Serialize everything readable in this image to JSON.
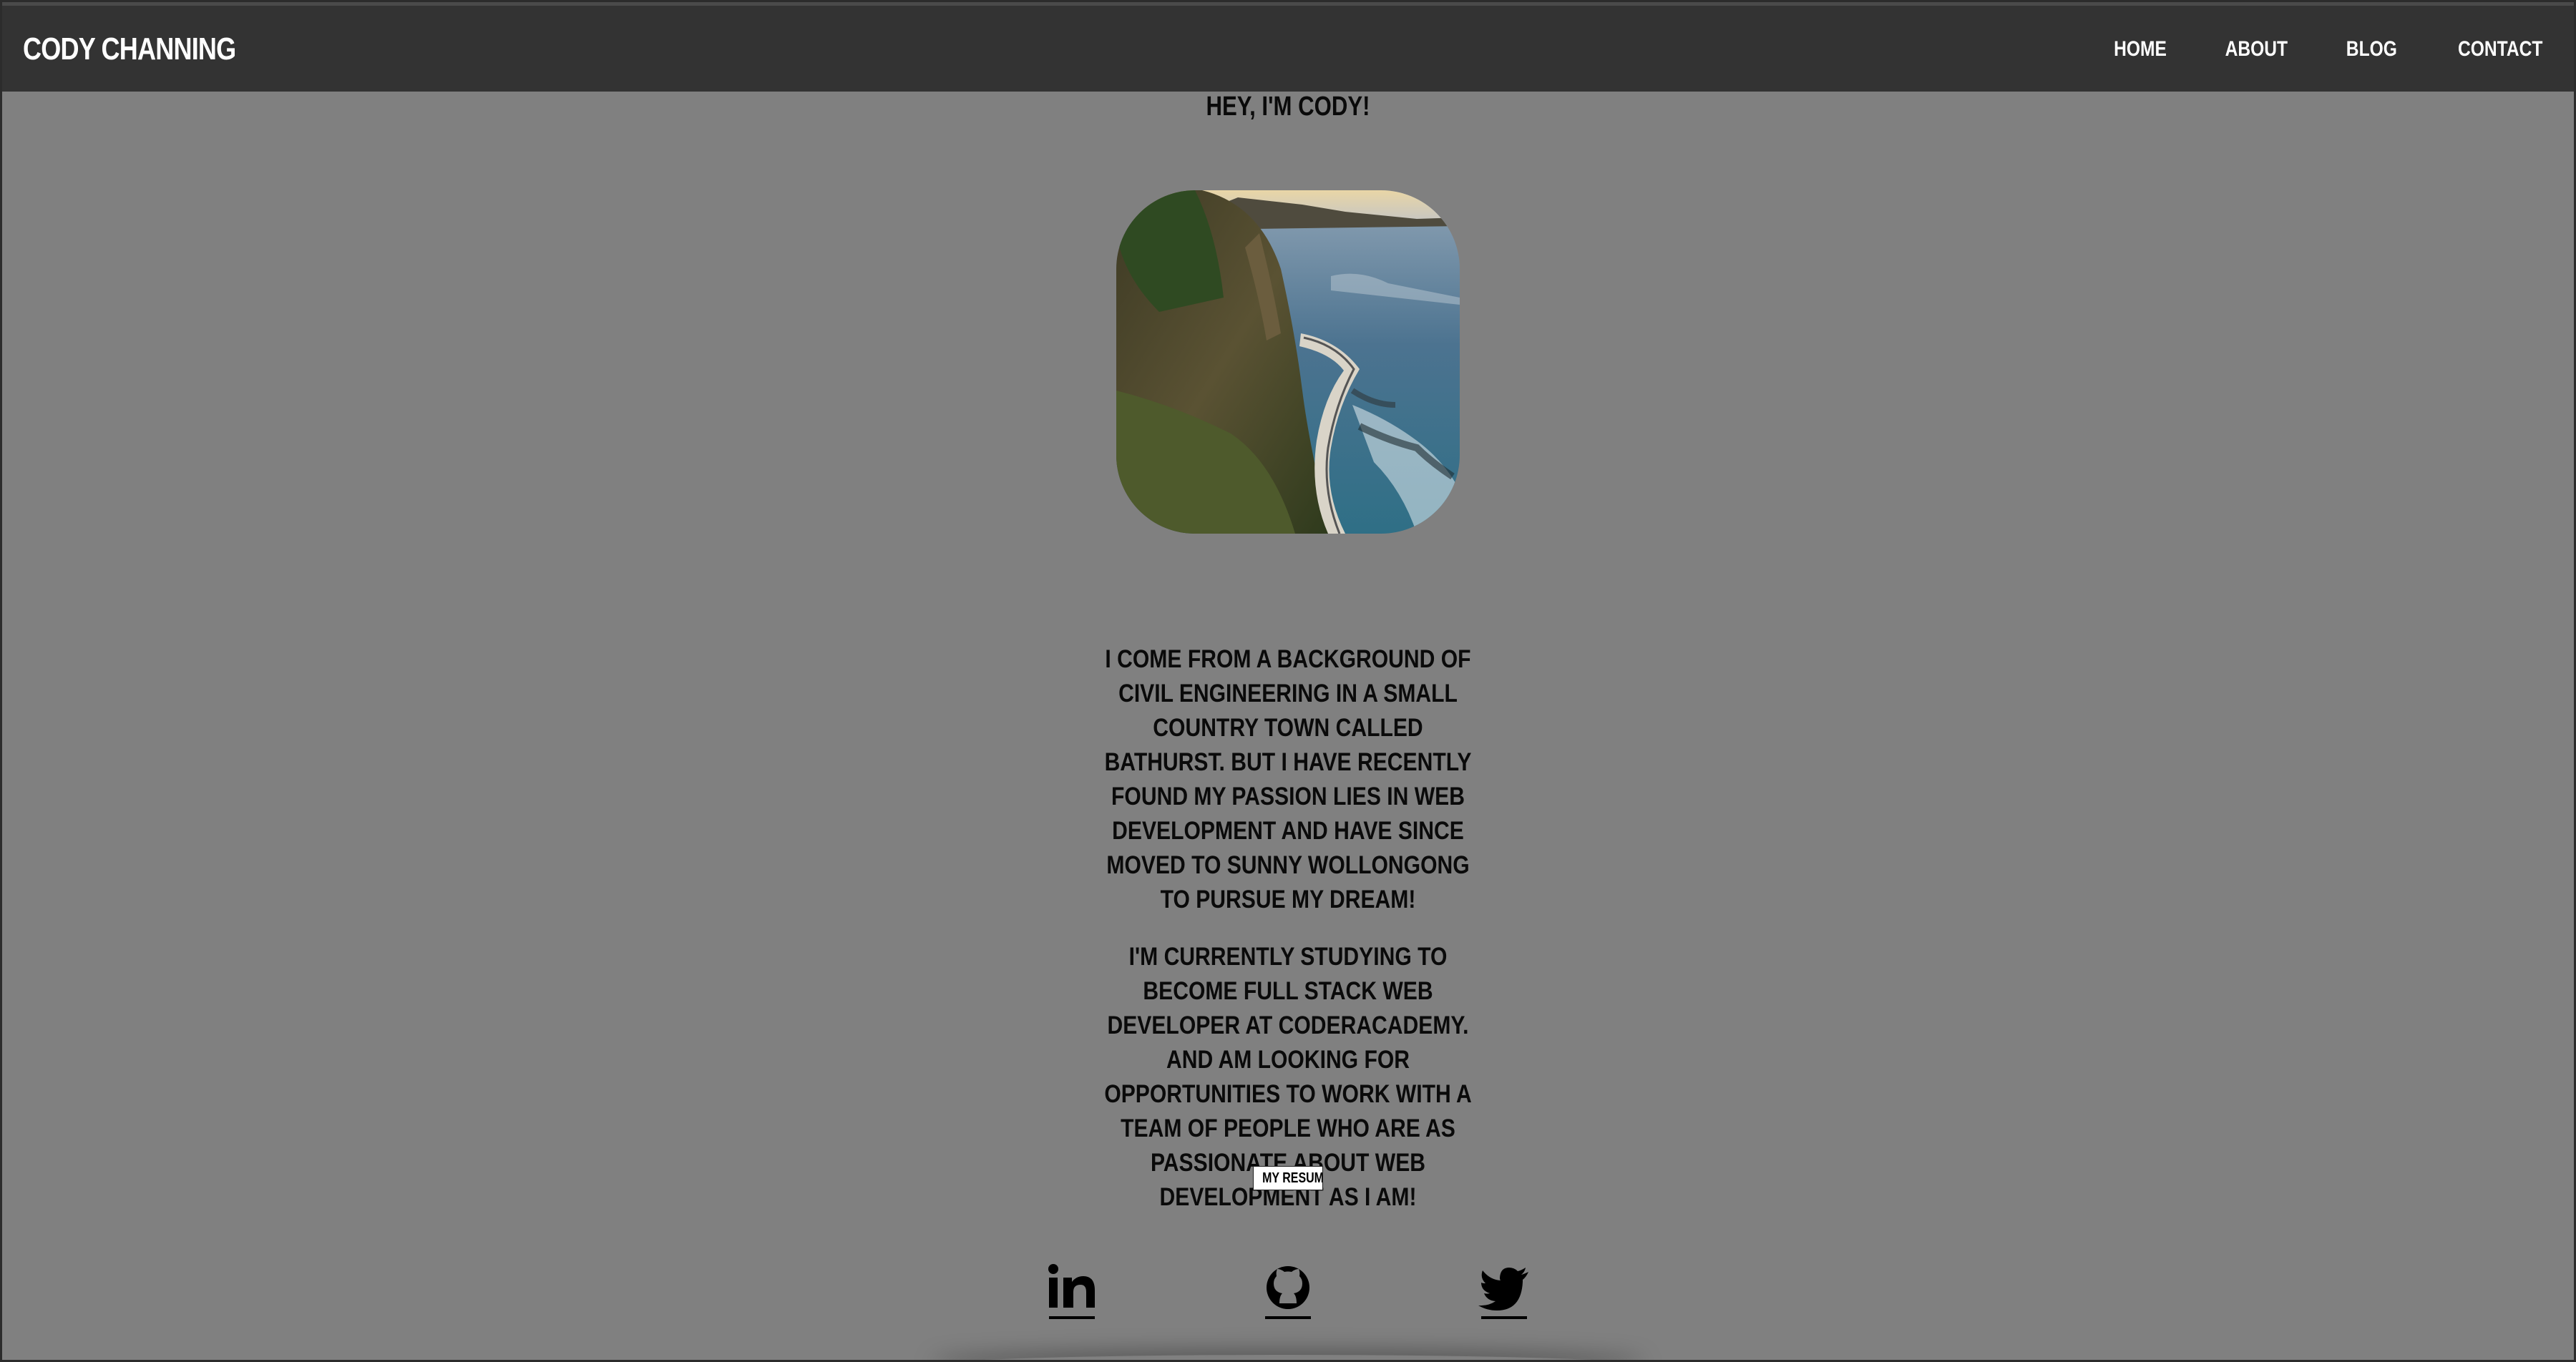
{
  "header": {
    "brand": "CODY CHANNING",
    "nav": [
      {
        "label": "HOME"
      },
      {
        "label": "ABOUT"
      },
      {
        "label": "BLOG"
      },
      {
        "label": "CONTACT"
      }
    ]
  },
  "main": {
    "greeting": "HEY, I'M CODY!",
    "bio_paragraphs": [
      "I COME FROM A BACKGROUND OF CIVIL ENGINEERING IN A SMALL COUNTRY TOWN CALLED BATHURST. BUT I HAVE RECENTLY FOUND MY PASSION LIES IN WEB DEVELOPMENT AND HAVE SINCE MOVED TO SUNNY WOLLONGONG TO PURSUE MY DREAM!",
      "I'M CURRENTLY STUDYING TO BECOME FULL STACK WEB DEVELOPER AT CODERACADEMY. AND AM LOOKING FOR OPPORTUNITIES TO WORK WITH A TEAM OF PEOPLE WHO ARE AS PASSIONATE ABOUT WEB DEVELOPMENT AS I AM!"
    ],
    "resume_button": "MY RESUME",
    "socials": [
      {
        "icon": "linkedin-icon"
      },
      {
        "icon": "github-icon"
      },
      {
        "icon": "twitter-icon"
      }
    ]
  },
  "colors": {
    "background": "#808080",
    "header": "#333333",
    "text": "#0a0a0a",
    "nav_text": "#ffffff"
  }
}
